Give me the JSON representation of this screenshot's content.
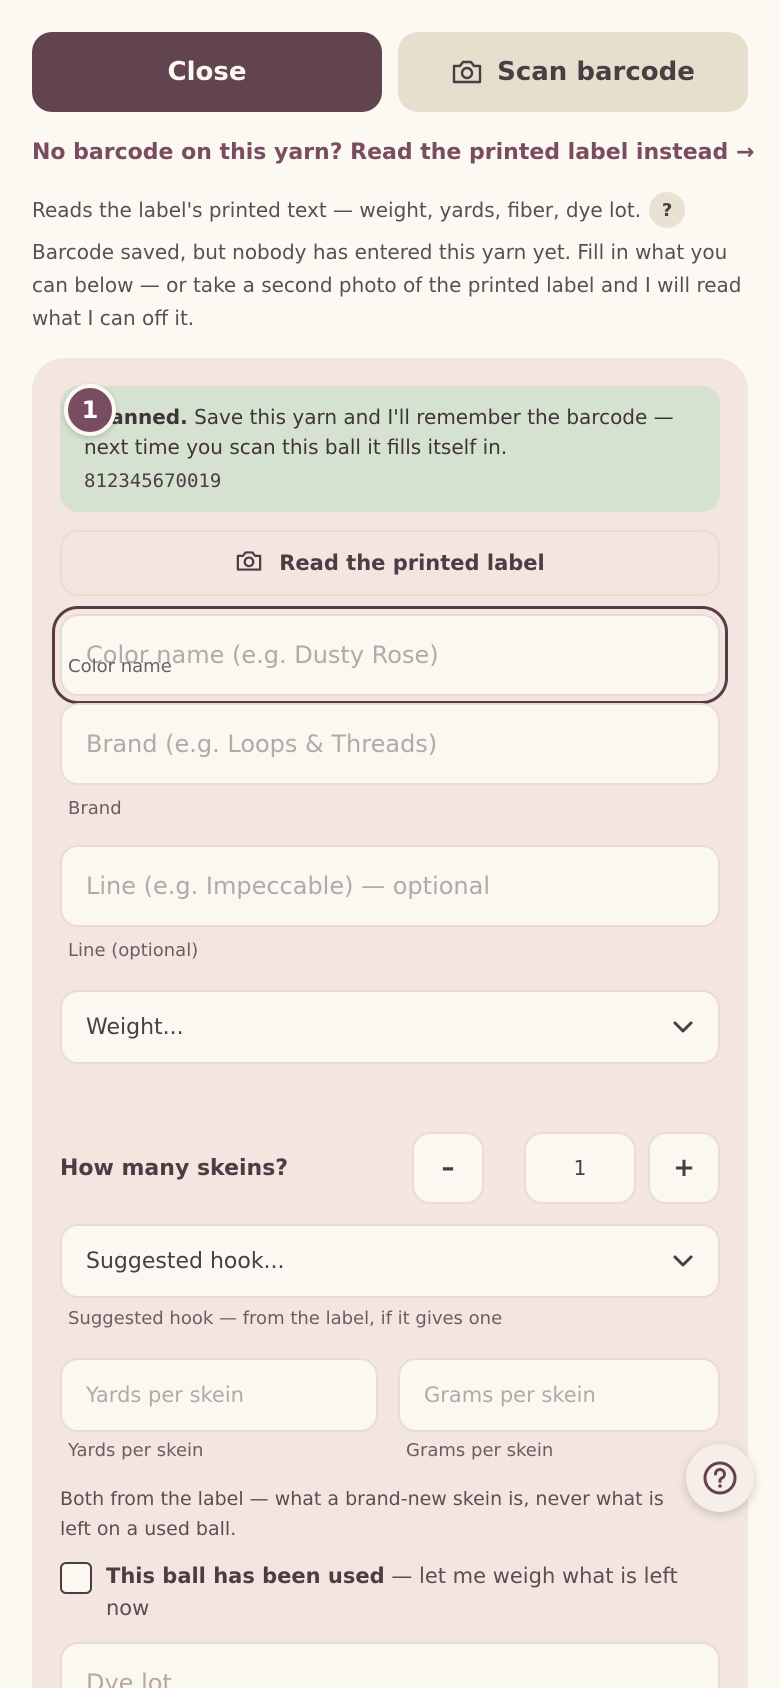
{
  "top": {
    "close_label": "Close",
    "scan_label": "Scan barcode"
  },
  "link_no_barcode": "No barcode on this yarn? Read the printed label instead →",
  "reads_line": "Reads the label's printed text — weight, yards, fiber, dye lot.",
  "help_chip": "?",
  "explain": "Barcode saved, but nobody has entered this yarn yet. Fill in what you can below — or take a second photo of the printed label and I will read what I can off it.",
  "scan_box": {
    "step": "1",
    "bold": "Scanned.",
    "text": "Save this yarn and I'll remember the barcode — next time you scan this ball it fills itself in.",
    "barcode": "812345670019"
  },
  "read_label_button": "Read the printed label",
  "fields": {
    "color": {
      "placeholder": "Color name (e.g. Dusty Rose)",
      "label": "Color name"
    },
    "brand": {
      "placeholder": "Brand (e.g. Loops & Threads)",
      "label": "Brand"
    },
    "line": {
      "placeholder": "Line (e.g. Impeccable) — optional",
      "label": "Line (optional)"
    },
    "weight_select": "Weight...",
    "skeins": {
      "label": "How many skeins?",
      "minus": "–",
      "value": "1",
      "plus": "+"
    },
    "hook_select": "Suggested hook...",
    "hook_label": "Suggested hook — from the label, if it gives one",
    "yards": {
      "placeholder": "Yards per skein",
      "label": "Yards per skein"
    },
    "grams": {
      "placeholder": "Grams per skein",
      "label": "Grams per skein"
    },
    "note": "Both from the label — what a brand-new skein is, never what is left on a used ball.",
    "used": {
      "bold": "This ball has been used",
      "rest": " — let me weigh what is left now"
    },
    "dye_lot": {
      "placeholder": "Dye lot"
    }
  },
  "icons": {
    "camera": "camera-icon",
    "chevron": "chevron-down-icon",
    "help": "help-circle-icon"
  },
  "colors": {
    "accent": "#624450",
    "card": "#f3e6e0",
    "success": "#d6e2d0"
  }
}
